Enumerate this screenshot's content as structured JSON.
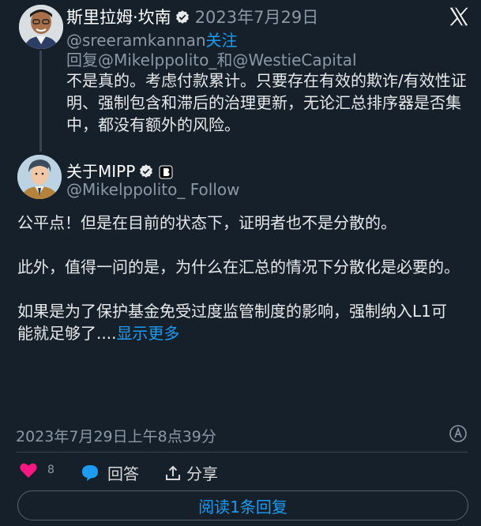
{
  "tweet_parent": {
    "author_name": "斯里拉姆·坎南",
    "date": "2023年7月29日",
    "handle": "@sreeramkannan",
    "follow_label": "关注",
    "reply_to": "回复@Mikelppolito_和@WestieCapital",
    "text": "不是真的。考虑付款累计。只要存在有效的欺诈/有效性证明、强制包含和滞后的治理更新，无论汇总排序器是否集中，都没有额外的风险。"
  },
  "tweet_main": {
    "author_name": "关于MIPP",
    "handle": "@Mikelppolito_",
    "follow_label": "Follow",
    "paragraphs": [
      "公平点！但是在目前的状态下，证明者也不是分散的。",
      "此外，值得一问的是，为什么在汇总的情况下分散化是必要的。",
      "如果是为了保护基金免受过度监管制度的影响，强制纳入L1可能就足够了...."
    ],
    "show_more": "显示更多",
    "timestamp": "2023年7月29日上午8点39分",
    "likes": "8",
    "reply_label": "回答",
    "share_label": "分享",
    "read_replies_label": "阅读1条回复"
  },
  "icons": {
    "logo": "x-logo-icon",
    "verified": "verified-badge-icon",
    "affiliate": "affiliate-badge-icon",
    "info": "info-icon",
    "like": "heart-icon",
    "reply": "reply-bubble-icon",
    "share": "share-icon"
  },
  "colors": {
    "background": "#15202b",
    "text": "#e7e9ea",
    "muted": "#8b98a5",
    "accent": "#1d9bf0",
    "like": "#f91880"
  }
}
